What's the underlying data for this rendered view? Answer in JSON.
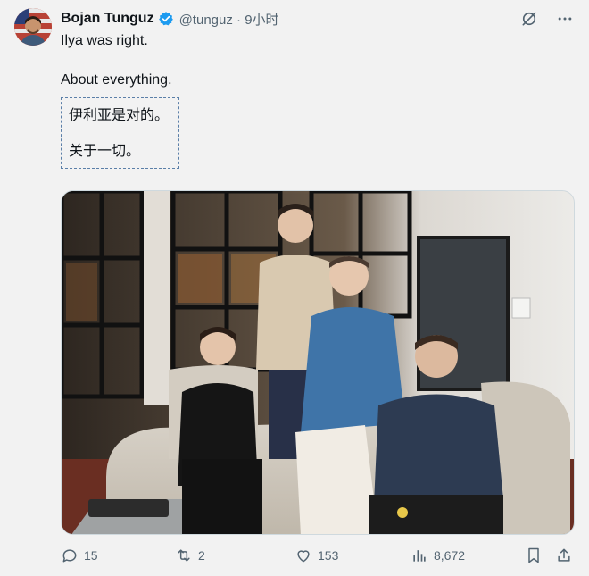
{
  "author": {
    "display_name": "Bojan Tunguz",
    "handle": "@tunguz",
    "separator": "·",
    "time": "9小时",
    "verified": true,
    "avatar_icon": "avatar-portrait-flag"
  },
  "tweet": {
    "line1": "Ilya was right.",
    "line2": "About everything."
  },
  "translation": {
    "line1": "伊利亚是对的。",
    "line2": "关于一切。"
  },
  "header_actions": {
    "grok_icon": "slashed-circle-icon",
    "more_icon": "more-dots-icon"
  },
  "actions": {
    "reply_count": "15",
    "retweet_count": "2",
    "like_count": "153",
    "views_count": "8,672"
  },
  "colors": {
    "accent": "#1d9bf0",
    "muted": "#536471",
    "text": "#0f1419",
    "background": "#f2f2f2"
  }
}
